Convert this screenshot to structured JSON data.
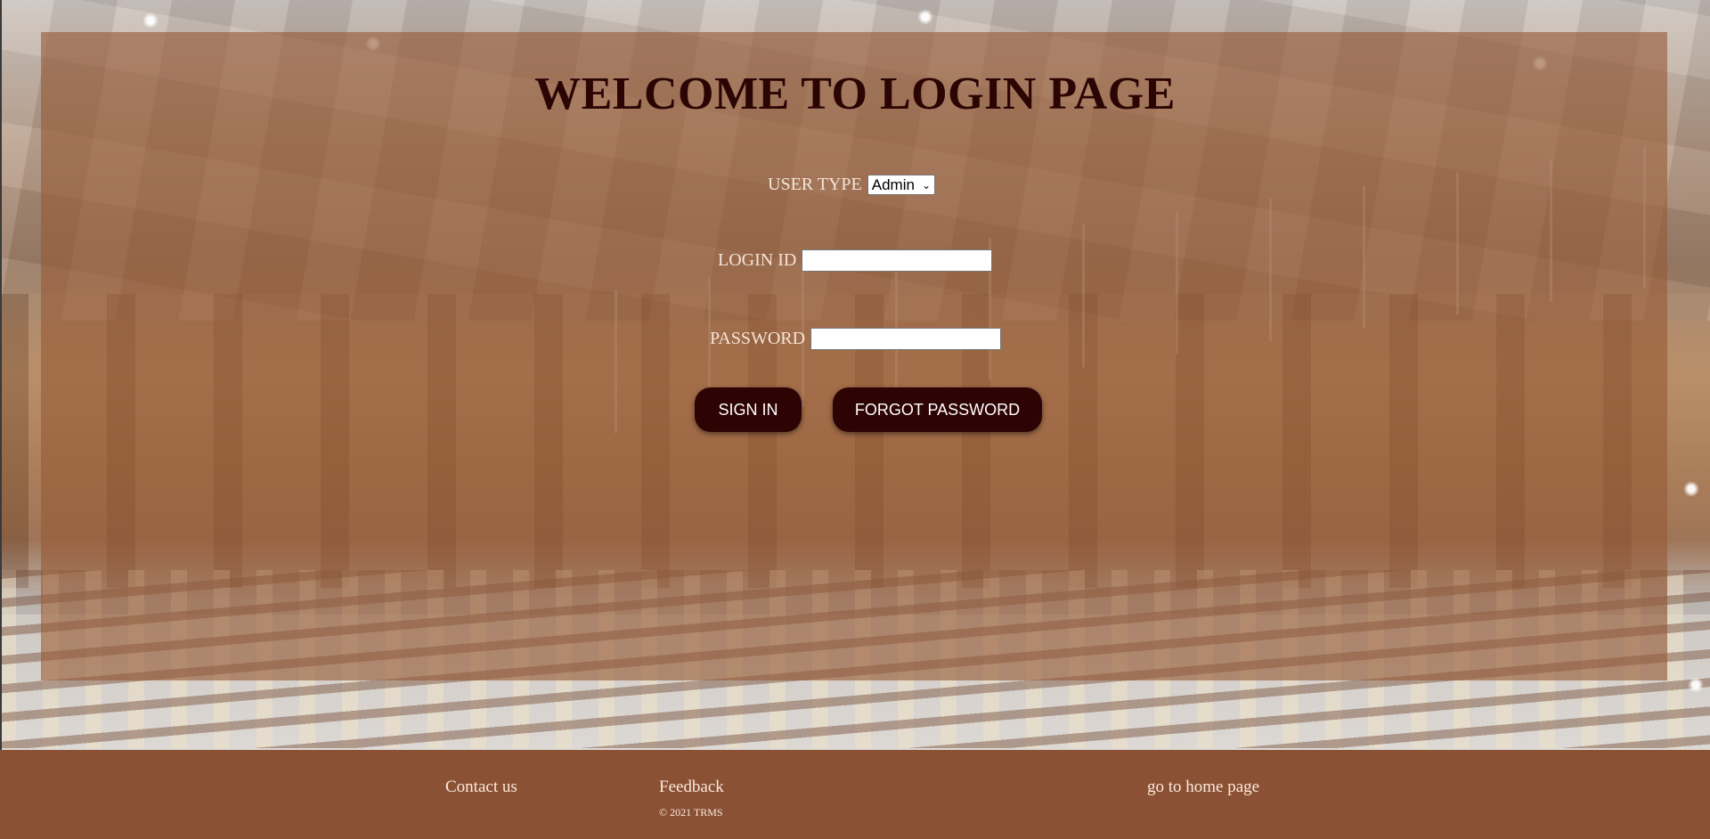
{
  "login": {
    "title": "WELCOME TO LOGIN PAGE",
    "user_type_label": "USER TYPE",
    "user_type_selected": "Admin",
    "login_id_label": "LOGIN ID",
    "login_id_value": "",
    "password_label": "PASSWORD",
    "password_value": "",
    "sign_in_label": "SIGN IN",
    "forgot_password_label": "FORGOT PASSWORD"
  },
  "footer": {
    "contact_label": "Contact us",
    "feedback_label": "Feedback",
    "copyright": "© 2021 TRMS",
    "home_link_label": "go to home page"
  },
  "colors": {
    "panel_overlay": "#965a37",
    "title_text": "#2b0404",
    "button_bg": "#2e0303",
    "footer_bg": "#8b5135",
    "label_text": "#f4e4d6"
  }
}
